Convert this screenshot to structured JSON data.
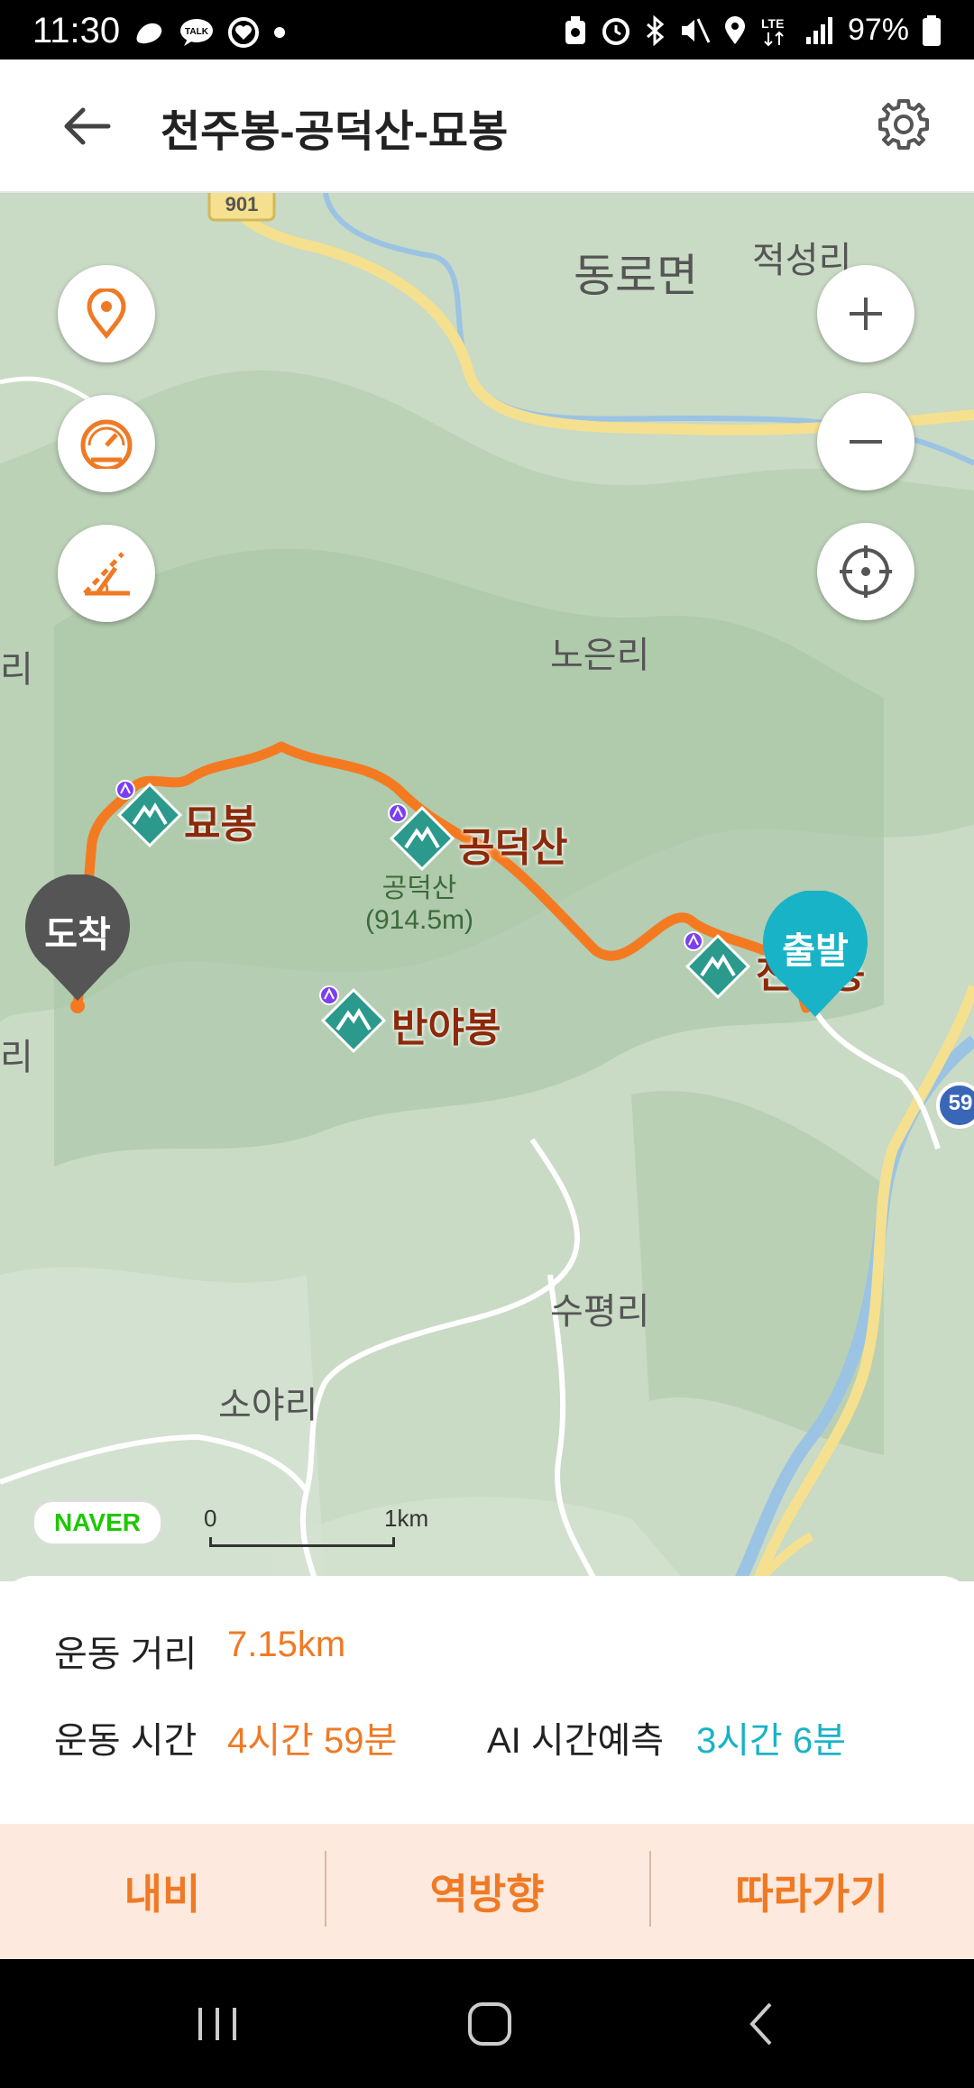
{
  "status_bar": {
    "time": "11:30",
    "left_icons": [
      "shoe-icon",
      "talk-icon",
      "heart-app-icon",
      "dot-icon"
    ],
    "right_icons": [
      "alarm-icon",
      "clock-icon",
      "bluetooth-icon",
      "mute-icon",
      "location-icon",
      "lte-icon",
      "signal-icon"
    ],
    "battery": "97%"
  },
  "header": {
    "title": "천주봉-공덕산-묘봉",
    "back_icon": "back-arrow-icon",
    "settings_icon": "gear-icon"
  },
  "map": {
    "places": {
      "dongro": "동로면",
      "jeokseong": "적성리",
      "noeun": "노은리",
      "supyeong": "수평리",
      "soya": "소야리",
      "edge_ri_1": "리",
      "edge_ri_2": "리"
    },
    "peaks": {
      "myobong": "묘봉",
      "gongdeok": "공덕산",
      "banyabong": "반야봉",
      "cheonju": "천주봉"
    },
    "peak_sub": {
      "name": "공덕산",
      "elevation": "(914.5m)"
    },
    "start_label": "출발",
    "end_label": "도착",
    "road_shield": "59",
    "road_shield_top": "901",
    "provider": "NAVER",
    "scale": {
      "min": "0",
      "max": "1km"
    },
    "route_color": "#F47A22",
    "start_color": "#18B3C7",
    "end_color": "#555555"
  },
  "controls": {
    "left": [
      "location-pin-icon",
      "speedometer-icon",
      "slope-icon"
    ],
    "right": [
      "zoom-in-icon",
      "zoom-out-icon",
      "crosshair-icon"
    ]
  },
  "stats": {
    "distance_label": "운동 거리",
    "distance_value": "7.15km",
    "time_label": "운동 시간",
    "time_value": "4시간 59분",
    "ai_label": "AI 시간예측",
    "ai_value": "3시간 6분"
  },
  "actions": {
    "navi": "내비",
    "reverse": "역방향",
    "follow": "따라가기"
  },
  "colors": {
    "accent": "#EF7A25",
    "ai": "#18B3C7",
    "action_bg": "#FDE9DD"
  }
}
